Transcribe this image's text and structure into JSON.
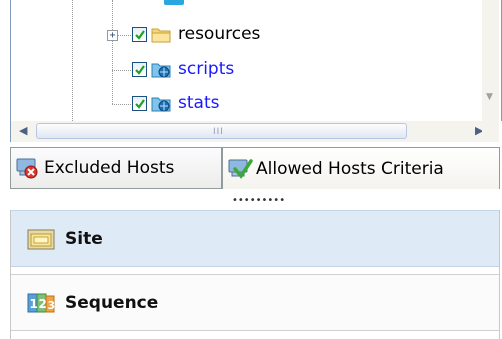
{
  "tree": {
    "items": [
      {
        "label": "resources",
        "type": "folder",
        "checked": true,
        "expandable": true
      },
      {
        "label": "scripts",
        "type": "site-folder",
        "checked": true,
        "expandable": false
      },
      {
        "label": "stats",
        "type": "site-folder",
        "checked": true,
        "expandable": false
      }
    ],
    "expander_symbol": "+"
  },
  "scrollbars": {
    "left_arrow": "◀",
    "right_arrow": "▶",
    "down_arrow": "▼",
    "grip": "III"
  },
  "tabs": [
    {
      "label": "Excluded Hosts",
      "icon": "excluded-hosts-icon",
      "active": false
    },
    {
      "label": "Allowed Hosts Criteria",
      "icon": "allowed-hosts-icon",
      "active": true
    }
  ],
  "tab_indicator": "•••••••••",
  "criteria_list": [
    {
      "label": "Site",
      "icon": "site-folder-icon",
      "selected": true
    },
    {
      "label": "Sequence",
      "icon": "sequence-123-icon",
      "selected": false
    }
  ],
  "colors": {
    "link": "#1a1aff",
    "selected_row": "#deeaf6",
    "border": "#919b9c"
  }
}
